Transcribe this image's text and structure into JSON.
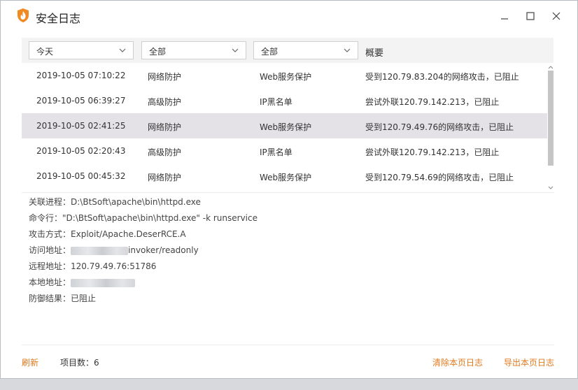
{
  "window": {
    "title": "安全日志"
  },
  "filters": {
    "time": "今天",
    "category": "全部",
    "type": "全部",
    "summary_header": "概要"
  },
  "rows": [
    {
      "time": "2019-10-05 07:10:22",
      "category": "网络防护",
      "type": "Web服务保护",
      "summary": "受到120.79.83.204的网络攻击，已阻止"
    },
    {
      "time": "2019-10-05 06:39:27",
      "category": "高级防护",
      "type": "IP黑名单",
      "summary": "尝试外联120.79.142.213，已阻止"
    },
    {
      "time": "2019-10-05 02:41:25",
      "category": "网络防护",
      "type": "Web服务保护",
      "summary": "受到120.79.49.76的网络攻击，已阻止"
    },
    {
      "time": "2019-10-05 02:20:43",
      "category": "高级防护",
      "type": "IP黑名单",
      "summary": "尝试外联120.79.142.213，已阻止"
    },
    {
      "time": "2019-10-05 00:45:32",
      "category": "网络防护",
      "type": "Web服务保护",
      "summary": "受到120.79.54.69的网络攻击，已阻止"
    }
  ],
  "details": {
    "process_label": "关联进程：",
    "process_value": "D:\\BtSoft\\apache\\bin\\httpd.exe",
    "cmd_label": "命令行：",
    "cmd_value": "\"D:\\BtSoft\\apache\\bin\\httpd.exe\" -k runservice",
    "attack_label": "攻击方式：",
    "attack_value": "Exploit/Apache.DeserRCE.A",
    "url_label": "访问地址：",
    "url_value": "invoker/readonly",
    "remote_label": "远程地址：",
    "remote_value": "120.79.49.76:51786",
    "local_label": "本地地址：",
    "result_label": "防御结果：",
    "result_value": "已阻止"
  },
  "footer": {
    "refresh": "刷新",
    "count_label": "项目数：",
    "count_value": "6",
    "clear": "清除本页日志",
    "export": "导出本页日志"
  },
  "colors": {
    "accent": "#e07a1f",
    "selected_row": "#e4e2e6",
    "filter_bar": "#f3f3f3"
  },
  "icons": {
    "app": "shield-flame-icon",
    "minimize": "minimize-icon",
    "maximize": "maximize-icon",
    "close": "close-icon",
    "dropdown": "chevron-down-icon"
  }
}
